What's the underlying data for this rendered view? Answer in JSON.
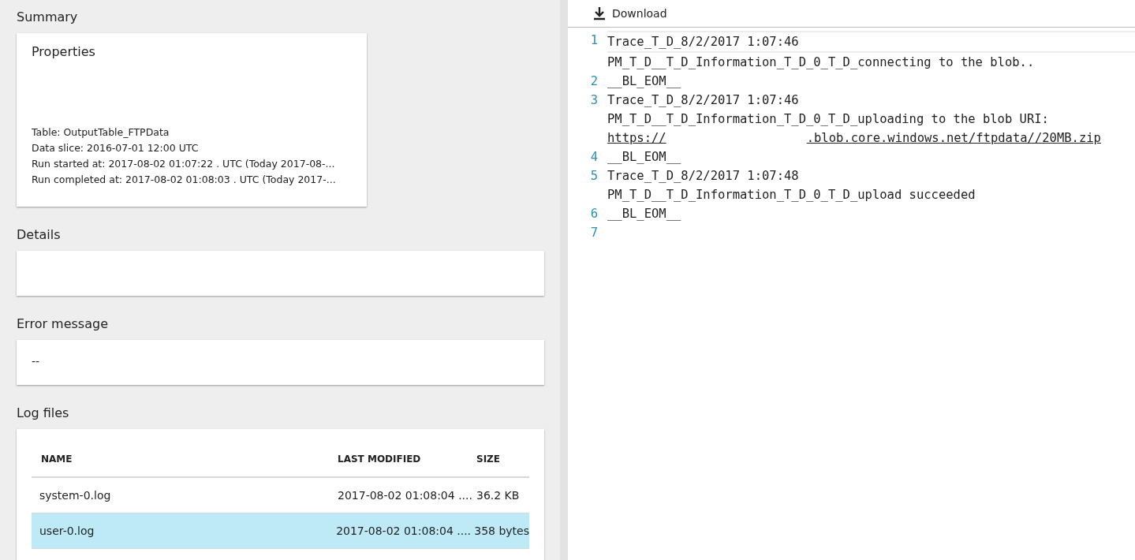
{
  "summary": {
    "heading": "Summary",
    "card_title": "Properties",
    "properties": [
      "Table: OutputTable_FTPData",
      "Data slice: 2016-07-01 12:00  UTC",
      "Run started at: 2017-08-02 01:07:22 . UTC (Today 2017-08-...",
      "Run completed at: 2017-08-02 01:08:03 . UTC (Today 2017-..."
    ]
  },
  "details": {
    "heading": "Details"
  },
  "error_message": {
    "heading": "Error message",
    "value": "--"
  },
  "log_files": {
    "heading": "Log files",
    "columns": [
      "NAME",
      "LAST MODIFIED",
      "SIZE"
    ],
    "rows": [
      {
        "name": "system-0.log",
        "last_modified": "2017-08-02 01:08:04 ....",
        "size": "36.2 KB",
        "selected": false
      },
      {
        "name": "user-0.log",
        "last_modified": "2017-08-02 01:08:04 ....",
        "size": "358 bytes",
        "selected": true
      }
    ]
  },
  "toolbar": {
    "download": "Download"
  },
  "editor": {
    "lines": [
      {
        "number": "1",
        "current": true,
        "rows": [
          [
            {
              "text": "Trace_T_D_8/2/2017 1:07:46",
              "link": false
            }
          ],
          [
            {
              "text": "PM_T_D__T_D_Information_T_D_0_T_D_connecting to the blob..",
              "link": false
            }
          ]
        ]
      },
      {
        "number": "2",
        "current": false,
        "rows": [
          [
            {
              "text": "__BL_EOM__",
              "link": false
            }
          ]
        ]
      },
      {
        "number": "3",
        "current": false,
        "rows": [
          [
            {
              "text": "Trace_T_D_8/2/2017 1:07:46",
              "link": false
            }
          ],
          [
            {
              "text": "PM_T_D__T_D_Information_T_D_0_T_D_uploading to the blob URI:",
              "link": false
            }
          ],
          [
            {
              "text": "https://",
              "link": true
            },
            {
              "text": ".blob.core.windows.net/ftpdata//20MB.zip",
              "link": true
            }
          ]
        ]
      },
      {
        "number": "4",
        "current": false,
        "rows": [
          [
            {
              "text": "__BL_EOM__",
              "link": false
            }
          ]
        ]
      },
      {
        "number": "5",
        "current": false,
        "rows": [
          [
            {
              "text": "Trace_T_D_8/2/2017 1:07:48",
              "link": false
            }
          ],
          [
            {
              "text": "PM_T_D__T_D_Information_T_D_0_T_D_upload succeeded",
              "link": false
            }
          ]
        ]
      },
      {
        "number": "6",
        "current": false,
        "rows": [
          [
            {
              "text": "__BL_EOM__",
              "link": false
            }
          ]
        ]
      },
      {
        "number": "7",
        "current": false,
        "rows": [
          []
        ]
      }
    ]
  }
}
